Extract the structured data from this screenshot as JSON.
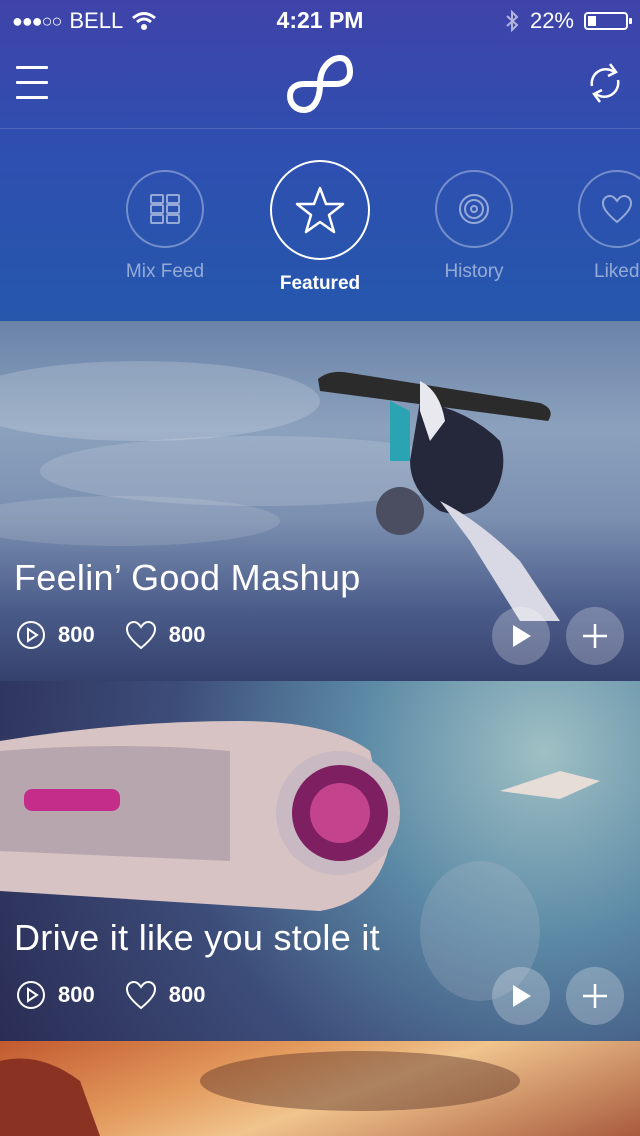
{
  "status_bar": {
    "carrier": "BELL",
    "time": "4:21 PM",
    "battery_percent": "22%",
    "battery_level": 0.22
  },
  "nav": {
    "menu_icon": "hamburger-menu-icon",
    "logo_icon": "8tracks-logo-icon",
    "refresh_icon": "refresh-icon"
  },
  "categories": [
    {
      "label": "Mix Feed",
      "icon": "grid-icon",
      "active": false
    },
    {
      "label": "Featured",
      "icon": "star-icon",
      "active": true
    },
    {
      "label": "History",
      "icon": "vinyl-record-icon",
      "active": false
    },
    {
      "label": "Liked",
      "icon": "heart-icon",
      "active": false
    }
  ],
  "cards": [
    {
      "title": "Feelin’ Good Mashup",
      "plays": "800",
      "likes": "800"
    },
    {
      "title": "Drive it like you stole it",
      "plays": "800",
      "likes": "800"
    }
  ],
  "colors": {
    "header_top": "#3f43a9",
    "header_bottom": "#2557ad"
  }
}
